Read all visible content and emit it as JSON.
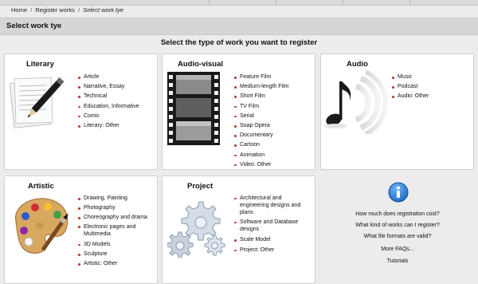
{
  "breadcrumb": {
    "home": "Home",
    "sep1": "/",
    "register": "Register works",
    "sep2": "/",
    "current": "Select work tye"
  },
  "header": {
    "title": "Select work tye"
  },
  "subtitle": "Select the type of work you want to register",
  "cards": {
    "literary": {
      "title": "Literary",
      "icon": "pencil-paper-icon",
      "items": [
        "Article",
        "Narrative, Essay",
        "Technical",
        "Education, Informative",
        "Comic",
        "Literary: Other"
      ]
    },
    "audiovisual": {
      "title": "Audio-visual",
      "icon": "film-strip-icon",
      "items": [
        "Feature Film",
        "Medium-length Film",
        "Short Film",
        "TV Film",
        "Serial",
        "Soap Opera",
        "Documentary",
        "Cartoon",
        "Animation",
        "Video: Other"
      ]
    },
    "audio": {
      "title": "Audio",
      "icon": "music-note-speaker-icon",
      "items": [
        "Music",
        "Podcast",
        "Audio: Other"
      ]
    },
    "artistic": {
      "title": "Artistic",
      "icon": "paint-palette-icon",
      "items": [
        "Drawing, Painting",
        "Photography",
        "Choreography and drama",
        "Electronic pages and Multimedia",
        "3D Models",
        "Sculpture",
        "Artistic: Other"
      ]
    },
    "project": {
      "title": "Project",
      "icon": "gears-icon",
      "items": [
        "Architectural and engineering designs and plans",
        "Software and Database designs",
        "Scale Model",
        "Project: Other"
      ]
    }
  },
  "faq": {
    "icon": "info-icon",
    "links": [
      "How much does registration cost?",
      "What kind of works can I register?",
      "What file formats are valid?",
      "More FAQs...",
      "Tutorials"
    ]
  },
  "colors": {
    "bullet": "#c0392b",
    "info": "#1f7fd6",
    "background": "#ececec",
    "header": "#d6d6d6"
  }
}
